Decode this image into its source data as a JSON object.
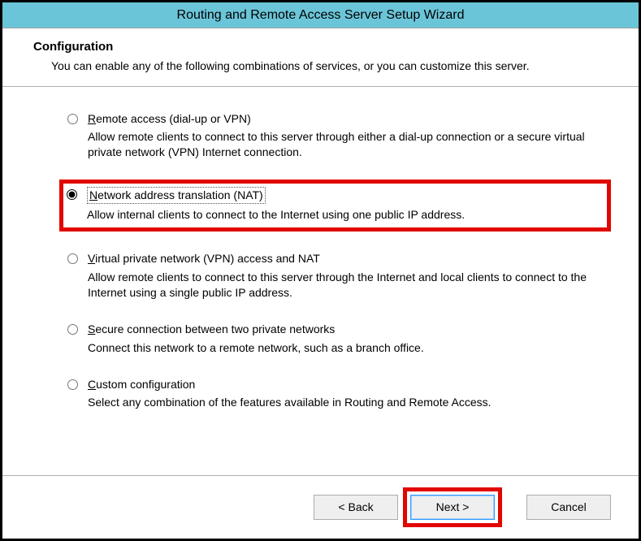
{
  "window": {
    "title": "Routing and Remote Access Server Setup Wizard"
  },
  "header": {
    "title": "Configuration",
    "description": "You can enable any of the following combinations of services, or you can customize this server."
  },
  "options": {
    "remote_access": {
      "accel": "R",
      "label_rest": "emote access (dial-up or VPN)",
      "desc": "Allow remote clients to connect to this server through either a dial-up connection or a secure virtual private network (VPN) Internet connection."
    },
    "nat": {
      "accel": "N",
      "label_rest": "etwork address translation (NAT)",
      "desc": "Allow internal clients to connect to the Internet using one public IP address."
    },
    "vpn_nat": {
      "accel": "V",
      "label_rest": "irtual private network (VPN) access and NAT",
      "desc": "Allow remote clients to connect to this server through the Internet and local clients to connect to the Internet using a single public IP address."
    },
    "secure": {
      "accel": "S",
      "label_rest": "ecure connection between two private networks",
      "desc": "Connect this network to a remote network, such as a branch office."
    },
    "custom": {
      "accel": "C",
      "label_rest": "ustom configuration",
      "desc": "Select any combination of the features available in Routing and Remote Access."
    }
  },
  "buttons": {
    "back_accel": "B",
    "back_prefix": "< ",
    "back_rest": "ack",
    "next_accel": "N",
    "next_rest": "ext >",
    "cancel": "Cancel"
  }
}
